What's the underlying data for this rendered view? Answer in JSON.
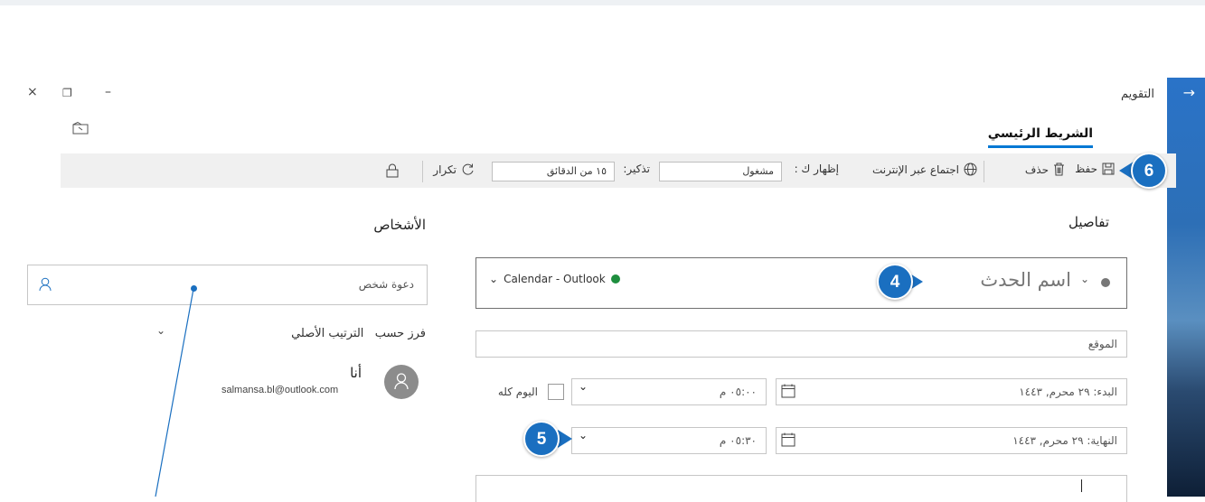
{
  "window": {
    "title": "التقويم",
    "controls": {
      "minimize": "–",
      "restore": "❐",
      "close": "×"
    }
  },
  "ribbon": {
    "tab": "الشريط الرئيسي",
    "save": "حفظ",
    "delete": "حذف",
    "online_meeting": "اجتماع عبر الإنترنت",
    "show_as_label": "إظهار ك :",
    "show_as_value": "مشغول",
    "reminder_label": "تذكير:",
    "reminder_value": "١٥ من الدقائق",
    "repeat": "تكرار"
  },
  "details": {
    "heading": "تفاصيل",
    "event_name_placeholder": "اسم الحدث",
    "calendar": "Calendar - Outlook",
    "location_placeholder": "الموقع",
    "start_label": "البدء:",
    "start_date": "٢٩ محرم, ١٤٤٣",
    "start_time": "٠٥:٠٠ م",
    "end_label": "النهاية:",
    "end_date": "٢٩ محرم, ١٤٤٣",
    "end_time": "٠٥:٣٠ م",
    "all_day": "اليوم كله"
  },
  "people": {
    "heading": "الأشخاص",
    "invite_placeholder": "دعوة شخص",
    "sort_label": "فرز حسب",
    "sort_value": "الترتيب الأصلي",
    "me_name": "أنا",
    "me_email": "salmansa.bl@outlook.com"
  },
  "callouts": {
    "four": "4",
    "five": "5",
    "six": "6"
  },
  "colors": {
    "accent": "#0078d4",
    "badge": "#1a6fc0",
    "calendar_dot": "#1e8e3e"
  },
  "icons": [
    "arrow-right-icon",
    "save-icon",
    "trash-icon",
    "globe-icon",
    "repeat-icon",
    "lock-icon",
    "calendar-icon",
    "person-icon",
    "detach-icon",
    "chevron-down-icon"
  ]
}
